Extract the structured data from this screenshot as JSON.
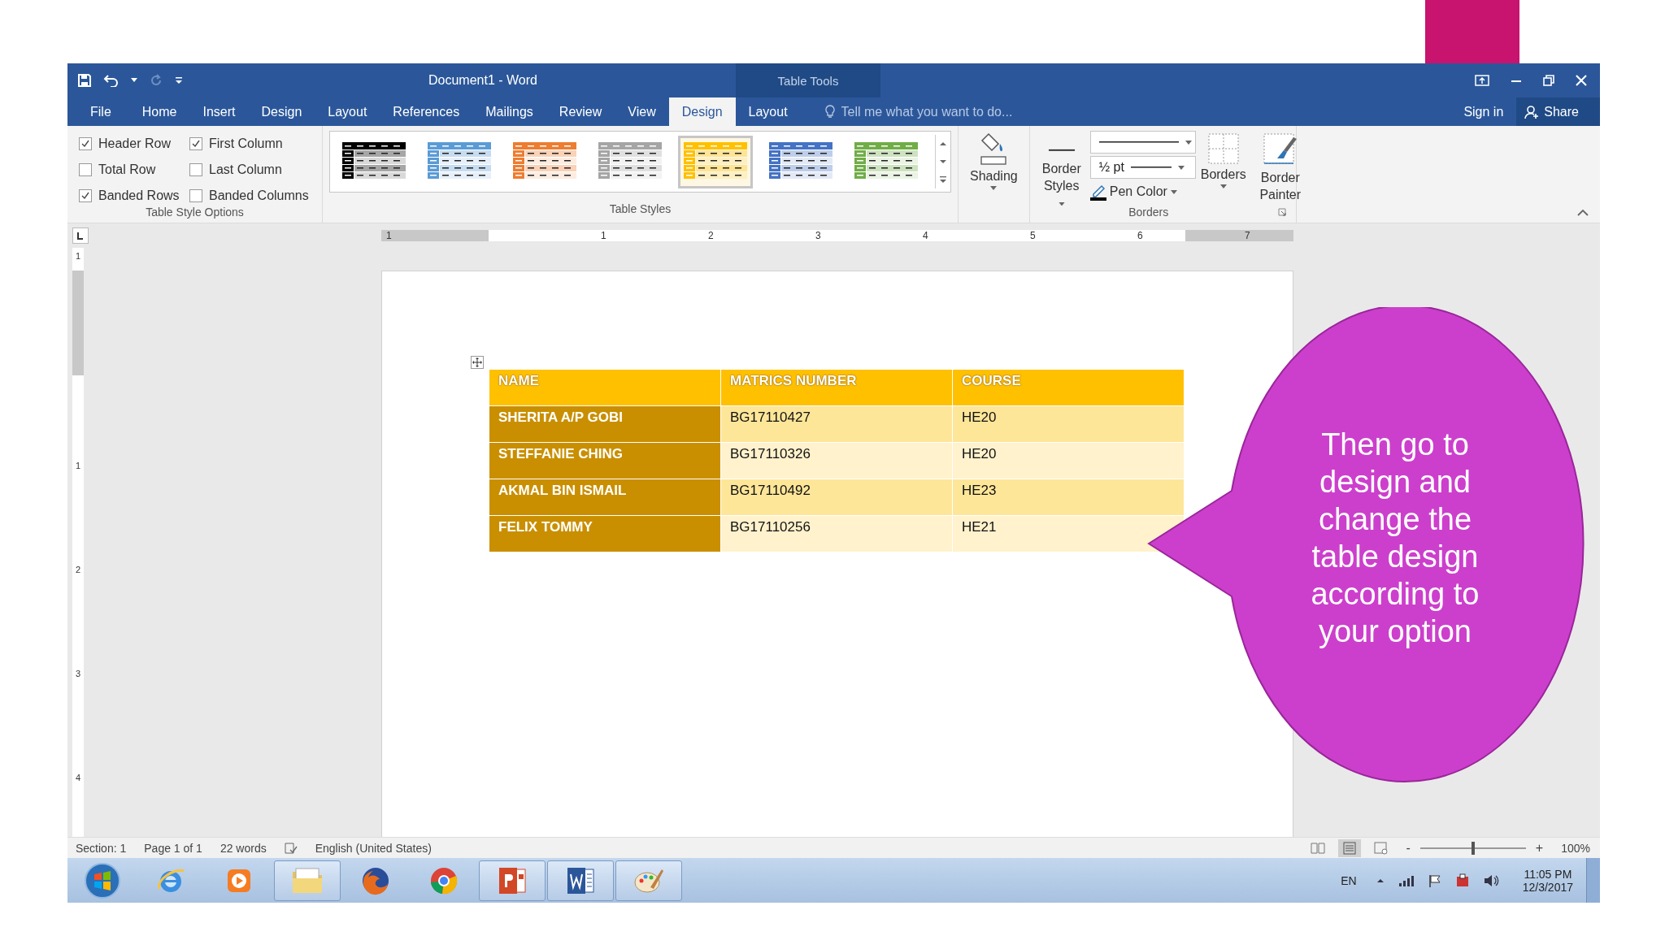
{
  "window": {
    "title": "Document1 - Word",
    "context_label": "Table Tools"
  },
  "tabs": [
    {
      "label": "File",
      "selected": false
    },
    {
      "label": "Home",
      "selected": false
    },
    {
      "label": "Insert",
      "selected": false
    },
    {
      "label": "Design",
      "selected": false
    },
    {
      "label": "Layout",
      "selected": false
    },
    {
      "label": "References",
      "selected": false
    },
    {
      "label": "Mailings",
      "selected": false
    },
    {
      "label": "Review",
      "selected": false
    },
    {
      "label": "View",
      "selected": false
    },
    {
      "label": "Design",
      "selected": true
    },
    {
      "label": "Layout",
      "selected": false
    }
  ],
  "tell_me": {
    "placeholder": "Tell me what you want to do..."
  },
  "account": {
    "sign_in": "Sign in",
    "share": "Share"
  },
  "style_options": {
    "label": "Table Style Options",
    "items": [
      {
        "label": "Header Row",
        "checked": true
      },
      {
        "label": "First Column",
        "checked": true
      },
      {
        "label": "Total Row",
        "checked": false
      },
      {
        "label": "Last Column",
        "checked": false
      },
      {
        "label": "Banded Rows",
        "checked": true
      },
      {
        "label": "Banded Columns",
        "checked": false
      }
    ]
  },
  "table_styles": {
    "label": "Table Styles",
    "items": [
      {
        "color": "#000000",
        "selected": false
      },
      {
        "color": "#5b9bd5",
        "selected": false
      },
      {
        "color": "#ed7d31",
        "selected": false
      },
      {
        "color": "#a5a5a5",
        "selected": false
      },
      {
        "color": "#ffc000",
        "selected": true
      },
      {
        "color": "#4472c4",
        "selected": false
      },
      {
        "color": "#70ad47",
        "selected": false
      }
    ]
  },
  "shading": {
    "label": "Shading"
  },
  "borders": {
    "label": "Borders",
    "border_styles": "Border Styles",
    "weight": "½ pt",
    "pen_color": "Pen Color",
    "borders_button": "Borders",
    "border_painter": "Border Painter"
  },
  "ruler": {
    "horizontal": [
      "1",
      "1",
      "2",
      "3",
      "4",
      "5",
      "6",
      "7"
    ],
    "vertical": [
      "1",
      "1",
      "2",
      "3",
      "4"
    ]
  },
  "table": {
    "columns": [
      "NAME",
      "MATRICS NUMBER",
      "COURSE"
    ],
    "rows": [
      [
        "SHERITA A/P GOBI",
        "BG17110427",
        "HE20"
      ],
      [
        "STEFFANIE CHING",
        "BG17110326",
        "HE20"
      ],
      [
        "AKMAL BIN ISMAIL",
        "BG17110492",
        "HE23"
      ],
      [
        "FELIX TOMMY",
        "BG17110256",
        "HE21"
      ]
    ]
  },
  "status_bar": {
    "section": "Section: 1",
    "page": "Page 1 of 1",
    "words": "22 words",
    "language": "English (United States)",
    "zoom_out": "-",
    "zoom_in": "+",
    "zoom": "100%",
    "level": 0.5
  },
  "taskbar": {
    "items": [
      {
        "kind": "start",
        "running": false
      },
      {
        "kind": "browser",
        "running": false
      },
      {
        "kind": "media",
        "running": false
      },
      {
        "kind": "folder",
        "running": true
      },
      {
        "kind": "firefox",
        "running": false
      },
      {
        "kind": "chrome",
        "running": false
      },
      {
        "kind": "powerpoint",
        "running": true
      },
      {
        "kind": "word",
        "running": true
      },
      {
        "kind": "paint",
        "running": true
      }
    ],
    "language": "EN",
    "time": "11:05 PM",
    "date": "12/3/2017"
  },
  "callout": {
    "text": "Then go to design and change the table design according to your option"
  }
}
